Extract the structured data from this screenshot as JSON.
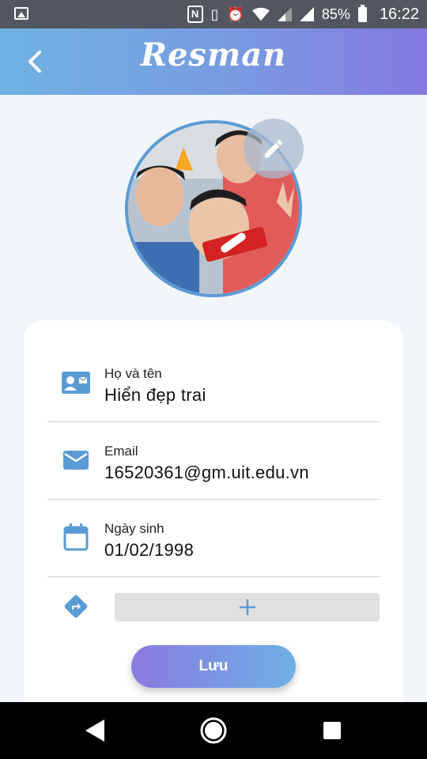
{
  "status_bar": {
    "battery_percent": "85%",
    "time": "16:22",
    "icons": [
      "gallery-icon",
      "nfc-icon",
      "vibrate-icon",
      "alarm-icon",
      "wifi-icon",
      "signal-icon",
      "signal-icon",
      "battery-icon"
    ]
  },
  "app_bar": {
    "title": "Resman",
    "back_icon": "chevron-left-icon"
  },
  "profile": {
    "avatar_icon": "avatar-photo",
    "edit_icon": "pencil-icon"
  },
  "form": {
    "fields": [
      {
        "label": "Họ và tên",
        "value": "Hiển đẹp trai",
        "icon": "contact-card-icon"
      },
      {
        "label": "Email",
        "value": "16520361@gm.uit.edu.vn",
        "icon": "mail-icon"
      },
      {
        "label": "Ngày sinh",
        "value": "01/02/1998",
        "icon": "calendar-icon"
      }
    ],
    "address": {
      "icon": "directions-icon",
      "add_icon": "plus-icon"
    },
    "save_label": "Lưu"
  },
  "colors": {
    "accent": "#5b9bd5",
    "gradient_start": "#6fb2e3",
    "gradient_end": "#8479e0",
    "background": "#f2f5f9"
  }
}
